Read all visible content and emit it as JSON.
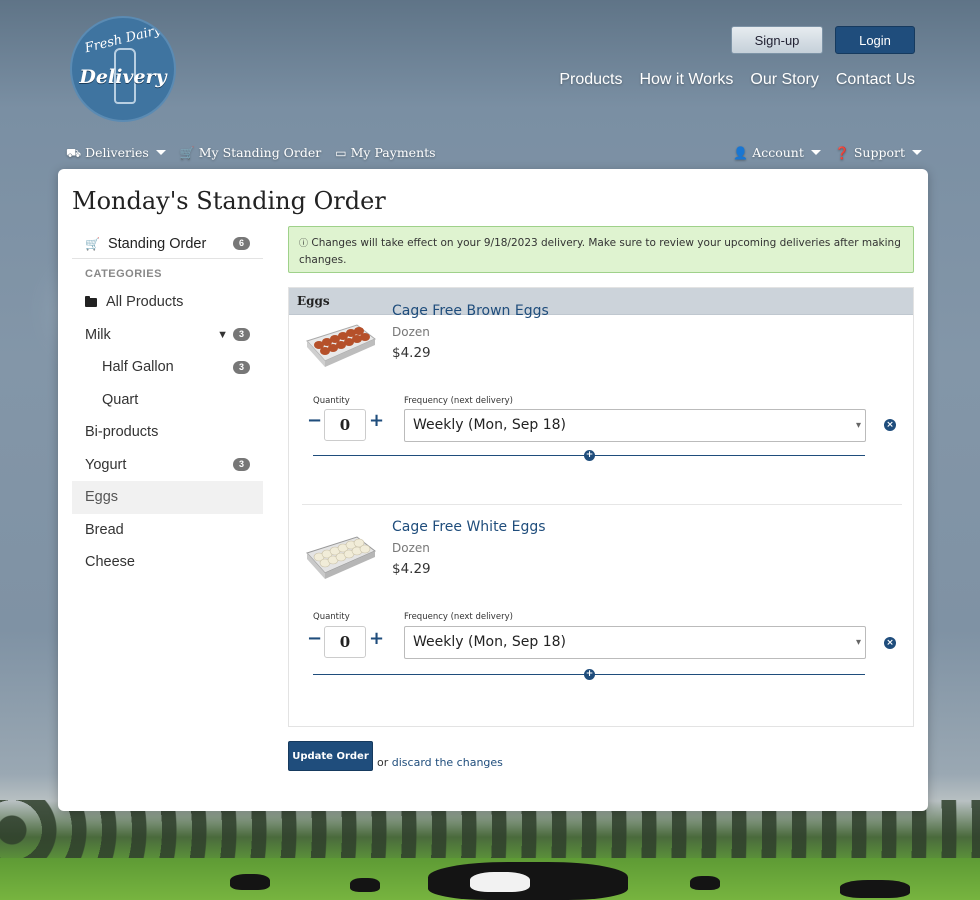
{
  "brand": {
    "logo_line1": "Fresh Dairy",
    "logo_line2": "Delivery",
    "accent_color": "#1f4d7c"
  },
  "header": {
    "signup_label": "Sign-up",
    "login_label": "Login",
    "nav": [
      "Products",
      "How it Works",
      "Our Story",
      "Contact Us"
    ]
  },
  "subnav": {
    "deliveries": "Deliveries",
    "standing_order": "My Standing Order",
    "payments": "My Payments",
    "account": "Account",
    "support": "Support"
  },
  "page": {
    "title": "Monday's Standing Order"
  },
  "sidebar": {
    "standing_order_label": "Standing Order",
    "standing_order_count": "6",
    "categories_heading": "CATEGORIES",
    "items": [
      {
        "label": "All Products",
        "count": ""
      },
      {
        "label": "Milk",
        "count": "3"
      },
      {
        "label": "Half Gallon",
        "count": "3"
      },
      {
        "label": "Quart",
        "count": ""
      },
      {
        "label": "Bi-products",
        "count": ""
      },
      {
        "label": "Yogurt",
        "count": "3"
      },
      {
        "label": "Eggs",
        "count": ""
      },
      {
        "label": "Bread",
        "count": ""
      },
      {
        "label": "Cheese",
        "count": ""
      }
    ]
  },
  "alert": {
    "text": "Changes will take effect on your 9/18/2023 delivery. Make sure to review your upcoming deliveries after making changes."
  },
  "panel": {
    "title": "Eggs",
    "quantity_label": "Quantity",
    "frequency_label": "Frequency (next delivery)",
    "products": [
      {
        "name": "Cage Free Brown Eggs",
        "unit": "Dozen",
        "price": "$4.29",
        "quantity": "0",
        "frequency": "Weekly (Mon, Sep 18)"
      },
      {
        "name": "Cage Free White Eggs",
        "unit": "Dozen",
        "price": "$4.29",
        "quantity": "0",
        "frequency": "Weekly (Mon, Sep 18)"
      }
    ]
  },
  "footer": {
    "update_label": "Update Order",
    "or_text": "or",
    "discard_label": "discard the changes"
  }
}
